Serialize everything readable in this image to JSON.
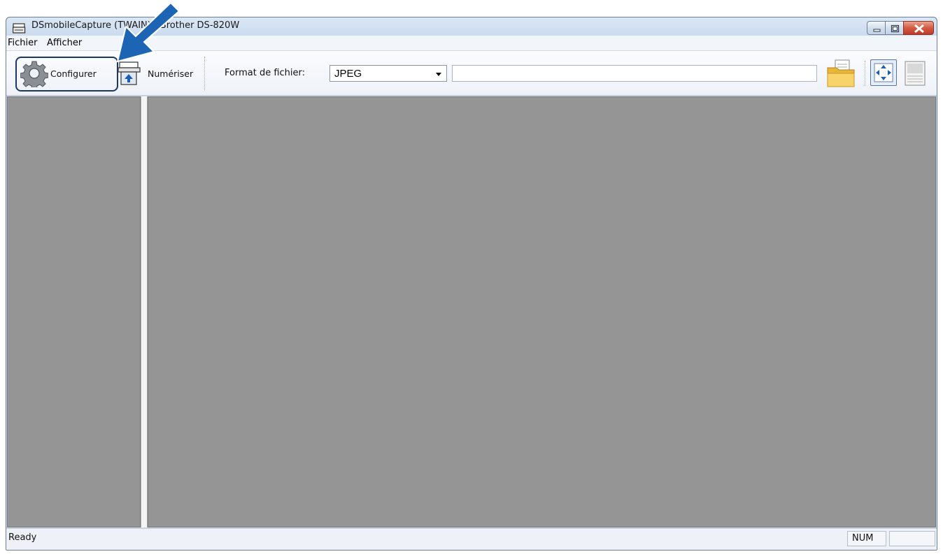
{
  "window": {
    "title": "DSmobileCapture (TWAIN) - Brother DS-820W"
  },
  "menu": {
    "items": [
      "Fichier",
      "Afficher"
    ]
  },
  "toolbar": {
    "configure_label": "Configurer",
    "scan_label": "Numériser",
    "format_label": "Format de fichier:",
    "format_value": "JPEG",
    "path_value": ""
  },
  "status": {
    "text": "Ready",
    "num": "NUM"
  },
  "icons": {
    "app": "scanner-icon",
    "configure": "gear-icon",
    "scan": "scanner-icon",
    "folder": "folder-icon",
    "fit": "fit-to-window-icon",
    "page": "page-view-icon",
    "annotation_arrow": "arrow-icon"
  },
  "colors": {
    "pane_gray": "#959595",
    "highlight": "#1a3768",
    "arrow": "#1e64b4",
    "close_red": "#c0392a"
  }
}
